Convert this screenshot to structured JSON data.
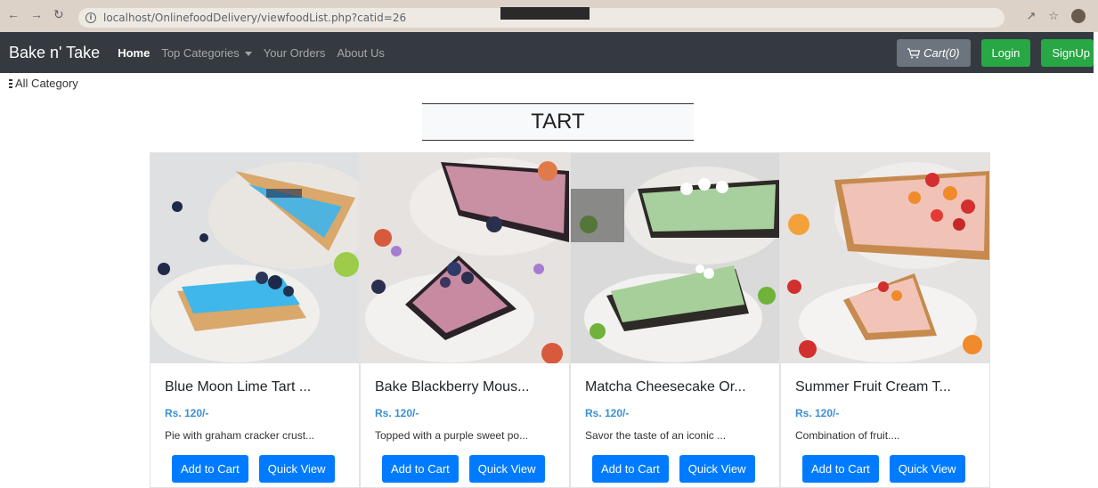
{
  "browser": {
    "url": "localhost/OnlinefoodDelivery/viewfoodList.php?catid=26"
  },
  "navbar": {
    "brand": "Bake n' Take",
    "links": [
      "Home",
      "Top Categories",
      "Your Orders",
      "About Us"
    ],
    "cart_label": "Cart(0)",
    "login_label": "Login",
    "signup_label": "SignUp"
  },
  "all_category_label": "All Category",
  "category_title": "TART",
  "products": [
    {
      "name": "Blue Moon Lime Tart ...",
      "price": "Rs. 120/-",
      "desc": "Pie with graham cracker crust...",
      "add_label": "Add to Cart",
      "view_label": "Quick View"
    },
    {
      "name": "Bake Blackberry Mous...",
      "price": "Rs. 120/-",
      "desc": "Topped with a purple sweet po...",
      "add_label": "Add to Cart",
      "view_label": "Quick View"
    },
    {
      "name": "Matcha Cheesecake Or...",
      "price": "Rs. 120/-",
      "desc": "Savor the taste of an iconic ...",
      "add_label": "Add to Cart",
      "view_label": "Quick View"
    },
    {
      "name": "Summer Fruit Cream T...",
      "price": "Rs. 120/-",
      "desc": "Combination of fruit....",
      "add_label": "Add to Cart",
      "view_label": "Quick View"
    }
  ],
  "colors": {
    "navbar": "#343a40",
    "primary": "#007bff",
    "success": "#28a745",
    "secondary": "#6c757d",
    "price": "#3b8fd4"
  }
}
